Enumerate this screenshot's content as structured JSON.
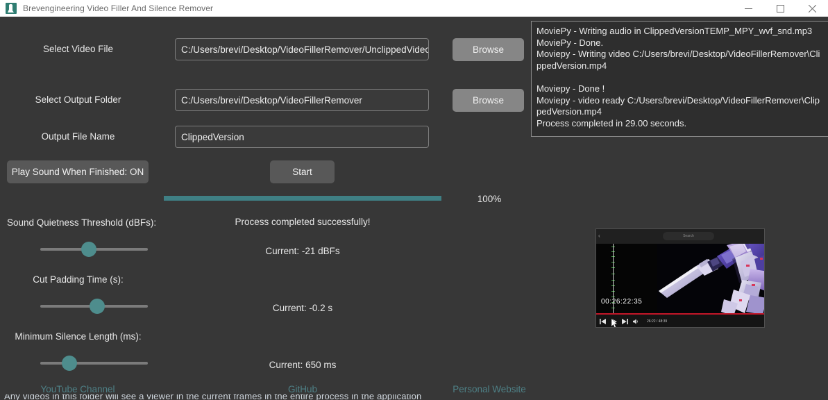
{
  "window": {
    "title": "Brevengineering Video Filler And Silence Remover",
    "icon": "app-icon",
    "controls": {
      "minimize": "minimize-icon",
      "maximize": "maximize-icon",
      "close": "close-icon"
    }
  },
  "theme": {
    "background": "#373737",
    "titlebar_bg": "#ffffff",
    "accent_teal": "#4e8d8d",
    "progress_fill": "#3f7f84",
    "link_color": "#4e8086",
    "input_bg": "#3a3a3a",
    "input_border": "#7d7d7d",
    "button_bg": "#868686",
    "button_dark_bg": "#585858",
    "console_bg": "#2e2e2e",
    "text_color": "#e8e8e8"
  },
  "form": {
    "video_file": {
      "label": "Select Video File",
      "value": "C:/Users/brevi/Desktop/VideoFillerRemover/UnclippedVideo",
      "browse_label": "Browse"
    },
    "output_folder": {
      "label": "Select Output Folder",
      "value": "C:/Users/brevi/Desktop/VideoFillerRemover",
      "browse_label": "Browse"
    },
    "output_file_name": {
      "label": "Output File Name",
      "value": "ClippedVersion"
    }
  },
  "actions": {
    "sound_toggle_label": "Play Sound When Finished: ON",
    "start_label": "Start"
  },
  "progress": {
    "percent_label": "100%",
    "percent_value": 100,
    "status_message": "Process completed successfully!"
  },
  "sliders": [
    {
      "label": "Sound Quietness Threshold (dBFs):",
      "current_label": "Current: -21 dBFs",
      "fraction": 0.45
    },
    {
      "label": "Cut Padding Time (s):",
      "current_label": "Current: -0.2 s",
      "fraction": 0.53
    },
    {
      "label": "Minimum Silence Length (ms):",
      "current_label": "Current: 650 ms",
      "fraction": 0.27
    }
  ],
  "console": {
    "lines": [
      "MoviePy - Writing audio in ClippedVersionTEMP_MPY_wvf_snd.mp3",
      "MoviePy - Done.",
      "Moviepy - Writing video C:/Users/brevi/Desktop/VideoFillerRemover\\ClippedVersion.mp4",
      "",
      "Moviepy - Done !",
      "Moviepy - video ready C:/Users/brevi/Desktop/VideoFillerRemover\\ClippedVersion.mp4",
      "Process completed in 29.00 seconds."
    ]
  },
  "links": [
    {
      "label": "YouTube Channel"
    },
    {
      "label": "GitHub"
    },
    {
      "label": "Personal Website"
    }
  ],
  "video_preview": {
    "search_placeholder": "Search",
    "timecode": "00:26:22:35",
    "time_display": "26:22 / 48:39",
    "controls": {
      "previous": "previous-track-icon",
      "play": "play-icon",
      "next": "next-track-icon",
      "volume": "volume-icon"
    }
  },
  "bottom_strip": {
    "clipped_text": "Any videos in this folder will see a viewer in the current frames in the entire process in the application"
  }
}
